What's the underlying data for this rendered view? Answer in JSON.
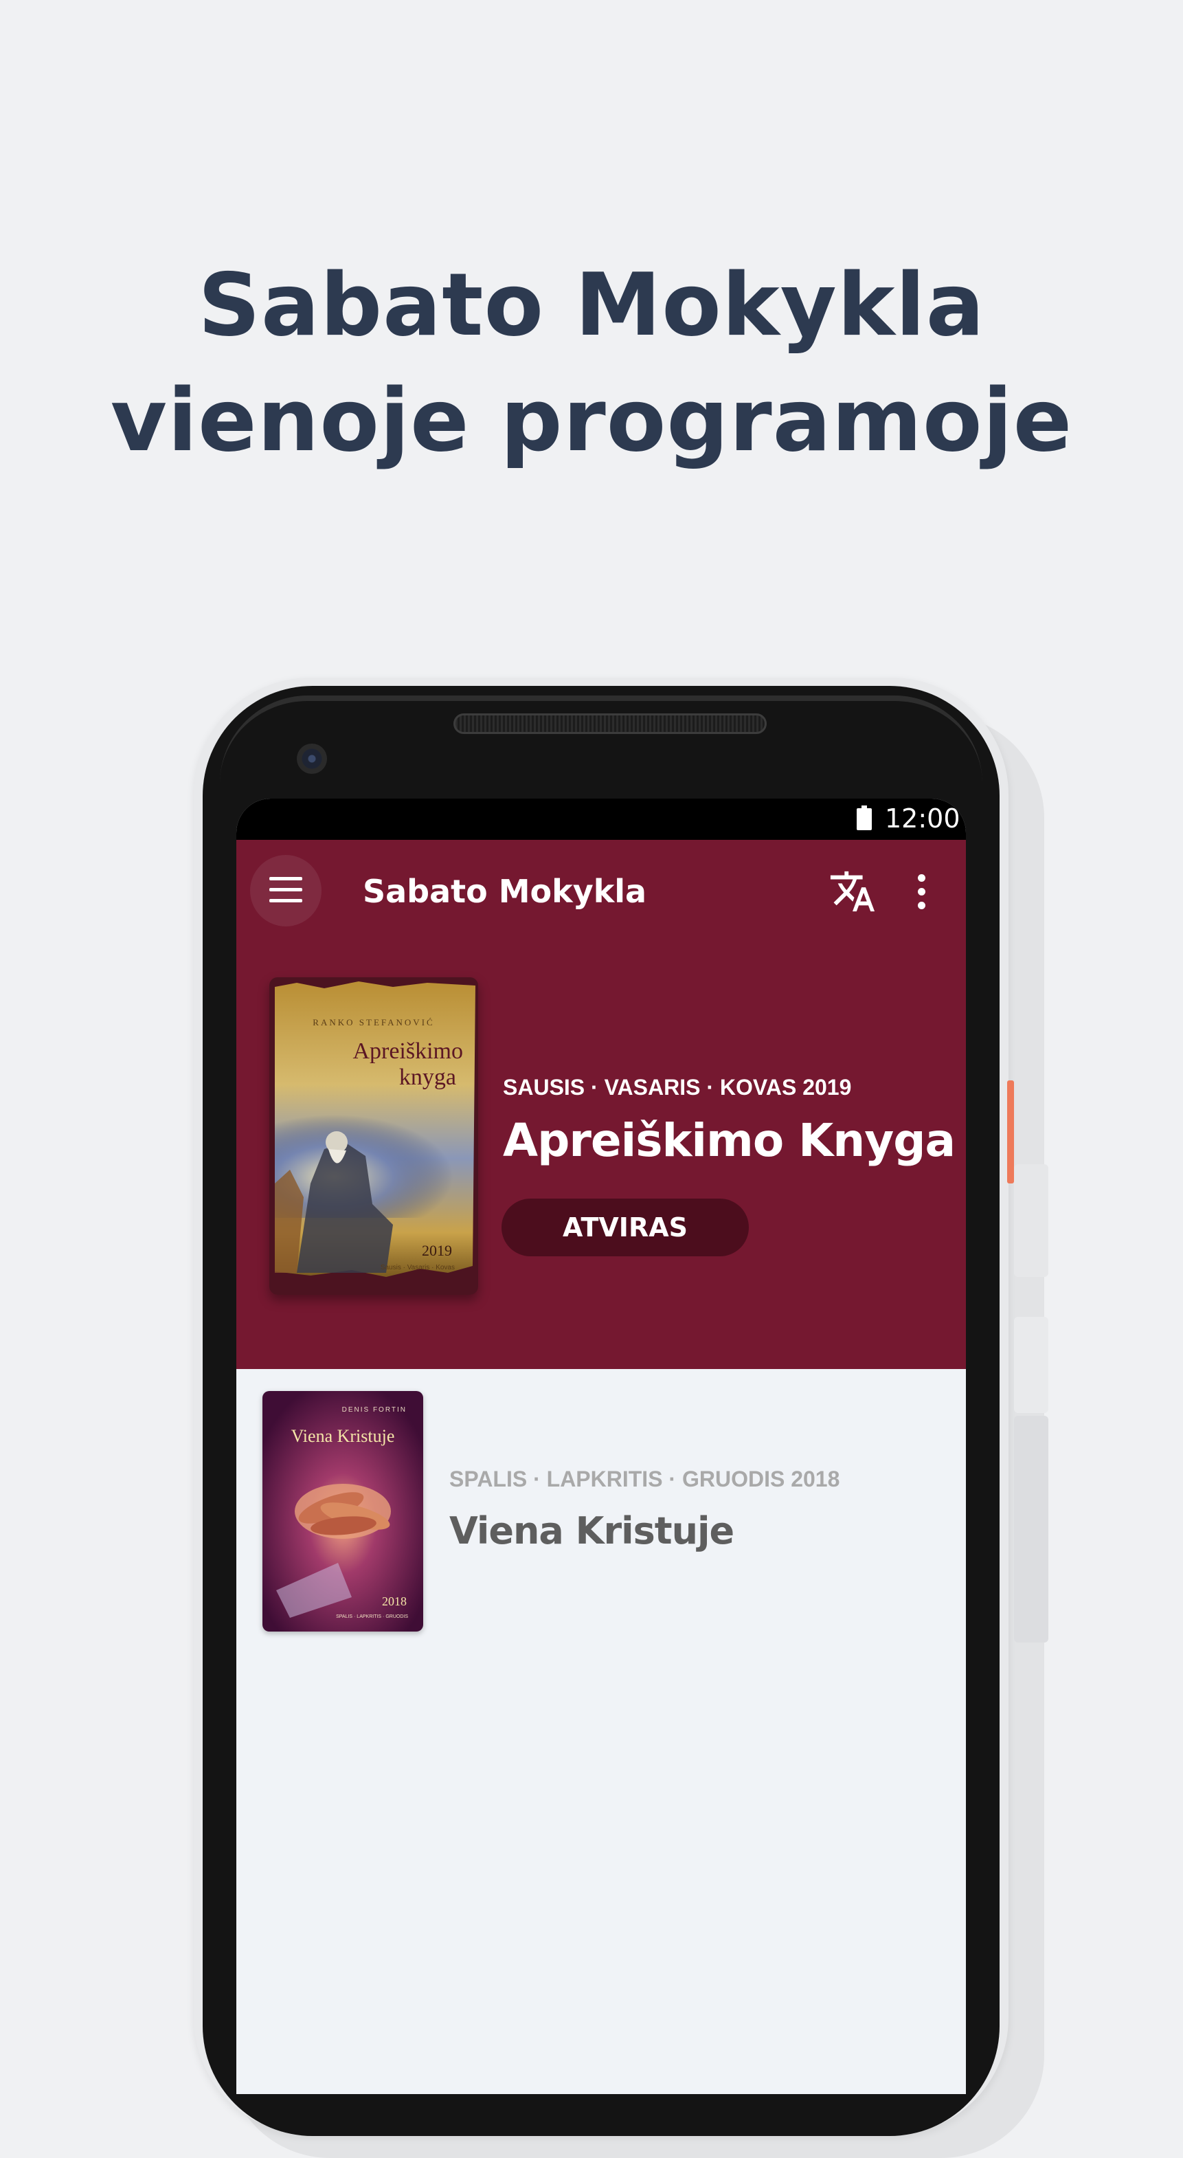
{
  "headline": {
    "line1": "Sabato Mokykla",
    "line2": "vienoje programoje"
  },
  "status_bar": {
    "time": "12:00",
    "battery_icon": "battery-full-icon"
  },
  "app_bar": {
    "title": "Sabato Mokykla",
    "menu_icon": "hamburger-menu-icon",
    "translate_icon": "translate-icon",
    "more_icon": "more-vertical-icon",
    "background": "#751830"
  },
  "featured": {
    "quarter": "SAUSIS · VASARIS · KOVAS 2019",
    "title": "Apreiškimo Knyga",
    "button_label": "ATVIRAS",
    "cover": {
      "author": "RANKO STEFANOVIĆ",
      "title_line1": "Apreiškimo",
      "title_line2": "knyga",
      "year": "2019",
      "quarter": "Sausis · Vasaris · Kovas"
    }
  },
  "quarterlies": [
    {
      "quarter": "SPALIS · LAPKRITIS · GRUODIS 2018",
      "title": "Viena Kristuje",
      "cover": {
        "author": "DENIS FORTIN",
        "title": "Viena Kristuje",
        "year": "2018",
        "quarter": "SPALIS · LAPKRITIS · GRUODIS"
      }
    }
  ]
}
